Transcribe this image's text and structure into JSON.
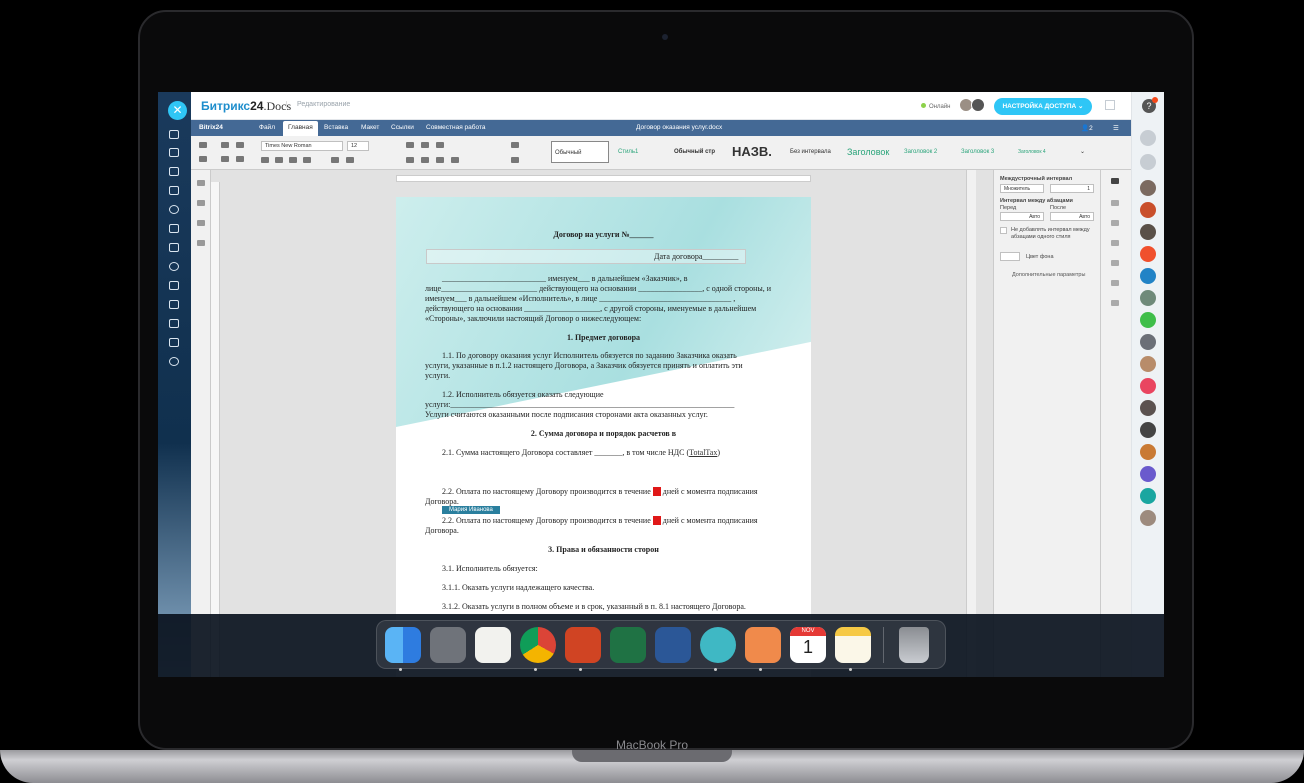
{
  "device": {
    "brand_label": "MacBook Pro"
  },
  "bitrix": {
    "logo_main": "Битрикс",
    "logo_num": "24",
    "logo_suffix": ".Docs",
    "edit_label": "Редактирование",
    "online_label": "Онлайн",
    "access_button": "НАСТРОЙКА ДОСТУПА"
  },
  "editor": {
    "menu_brand": "Bitrix24",
    "tabs": [
      "Файл",
      "Главная",
      "Вставка",
      "Макет",
      "Ссылки",
      "Совместная работа"
    ],
    "active_tab": "Главная",
    "doc_title": "Договор оказания услуг.docx",
    "font_name": "Times New Roman",
    "font_size": "12",
    "styles": [
      "Обычный",
      "Стиль1",
      "Обычный стр",
      "НАЗВ.",
      "Без интервала",
      "Заголовок",
      "Заголовок 2",
      "Заголовок 3",
      "Заголовок 4"
    ]
  },
  "paragraph_panel": {
    "line_spacing_title": "Междустрочный интервал",
    "line_spacing_mode": "Множитель",
    "line_spacing_value": "1",
    "para_spacing_title": "Интервал между абзацами",
    "before_label": "Перед",
    "after_label": "После",
    "before_value": "Авто",
    "after_value": "Авто",
    "no_space_checkbox": "Не добавлять интервал между абзацами одного стиля",
    "bg_color_label": "Цвет фона",
    "advanced_link": "Дополнительные параметры"
  },
  "document": {
    "title": "Договор на услуги №______",
    "date_line": "Дата договора_________",
    "intro": [
      "__________________________ именуем___ в дальнейшем «Заказчик», в",
      "лице________________________ действующего на основании ________________, с одной стороны, и",
      "именуем___ в дальнейшем «Исполнитель», в лице _________________________________ ,",
      "действующего на основании ___________________, с другой стороны, именуемые в дальнейшем",
      "«Стороны», заключили настоящий Договор о нижеследующем:"
    ],
    "section1": "1. Предмет договора",
    "p11": [
      "1.1. По договору оказания услуг Исполнитель обязуется по заданию Заказчика оказать",
      "услуги, указанные в п.1.2 настоящего Договора, а Заказчик обязуется принять и оплатить эти",
      "услуги."
    ],
    "p12": [
      "1.2. Исполнитель обязуется оказать следующие",
      "услуги:_______________________________________________________________________",
      "Услуги считаются оказанными после подписания сторонами акта оказанных услуг."
    ],
    "section2": "2. Сумма договора и порядок расчетов в",
    "p21_before": "2.1. Сумма настоящего Договора составляет _______, в том числе НДС (",
    "p21_link": "TotalTax",
    "p21_after": ")",
    "p22a_before": "2.2. Оплата по настоящему Договору производится в течение ",
    "p22a_mark": "10",
    "p22a_after": " дней с момента подписания",
    "p22a_end": "Договора.",
    "collab_user": "Мария Иванова",
    "p22b_before": "2.2. Оплата по настоящему Договору производится в течение ",
    "p22b_mark": "10",
    "p22b_after": " дней с момента подписания",
    "p22b_end": "Договора.",
    "section3": "3. Права и обязанности сторон",
    "p31": "3.1. Исполнитель обязуется:",
    "p311": "3.1.1. Оказать услуги надлежащего качества.",
    "p312": "3.1.2. Оказать услуги в полном объеме и в срок, указанный в п. 8.1 настоящего Договора."
  },
  "dock": {
    "apps": [
      "finder-icon",
      "system-preferences-icon",
      "notes-icon",
      "chrome-icon",
      "powerpoint-icon",
      "excel-icon",
      "word-icon",
      "bitrix24-icon",
      "bitrix24-desktop-icon",
      "calendar-icon",
      "notes-yellow-icon",
      "trash-icon"
    ],
    "calendar_month": "NOV",
    "calendar_day": "1"
  },
  "colors": {
    "accent": "#2fc6f6",
    "menu": "#446995",
    "brand_blue": "#1e8ecc"
  }
}
